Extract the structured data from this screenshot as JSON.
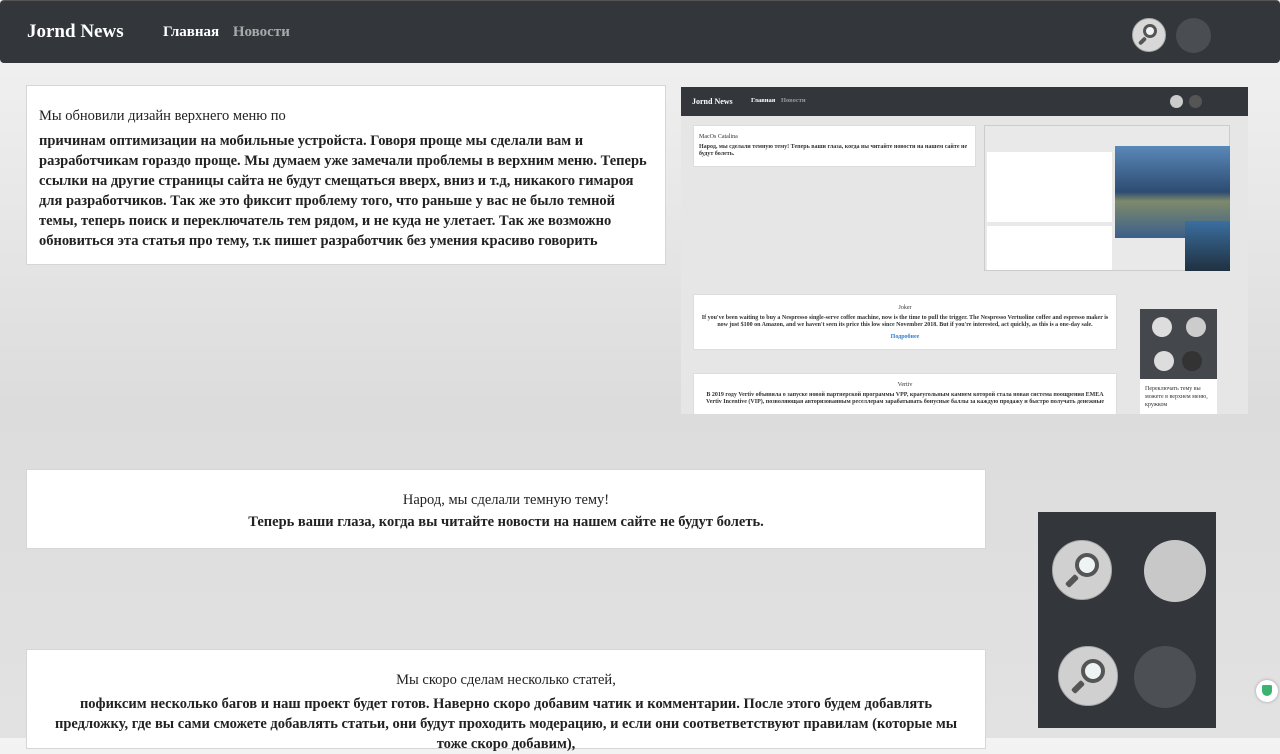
{
  "header": {
    "logo": "Jornd News",
    "nav": [
      "Главная",
      "Новости"
    ]
  },
  "card1": {
    "lead": "Мы обновили дизайн верхнего меню по",
    "body": "причинам оптимизации на мобильные устройста. Говоря проще мы сделали вам и разработчикам гораздо проще. Мы думаем уже замечали проблемы в верхним меню. Теперь ссылки на другие страницы сайта не будут смещаться вверх, вниз и т.д, никакого гимароя для разработчиков. Так же это фиксит проблему того, что раньше у вас не было темной темы, теперь поиск и переключатель тем рядом, и не куда не улетает. Так же возможно обновиться эта статья про тему, т.к пишет разработчик без умения красиво говорить"
  },
  "screenshot": {
    "logo": "Jornd News",
    "nav_home": "Главная",
    "nav_news": "Новости",
    "mini_a_title": "MacOs Catalina",
    "mini_a_text": "Народ, мы сделали темную тему! Теперь ваши глаза, когда вы читайте новости на нашем сайте не будут болеть.",
    "mini_b_title": "Joker",
    "mini_b_text": "If you've been waiting to buy a Nespresso single-serve coffee machine, now is the time to pull the trigger. The Nespresso Vertuoline coffee and espresso maker is now just $100 on Amazon, and we haven't seen its price this low since November 2018. But if you're interested, act quickly, as this is a one-day sale.",
    "mini_b_more": "Подробнее",
    "mini_c_title": "Vertiv",
    "mini_c_text": "В 2019 году Vertiv объявила о запуске новой партнерской программы VPP, краеугольным камнем которой стала новая система поощрения EMEA Vertiv Incentive (VIP), позволяющая авторизованным реселлерам зарабатывать бонусные баллы за каждую продажу и быстро получать денежные",
    "gadget_text": "Переключать тему вы можете в верхнем меню, кружком"
  },
  "card2": {
    "lead": "Народ, мы сделали темную тему!",
    "body": "Теперь ваши глаза, когда вы читайте новости на нашем сайте не будут болеть."
  },
  "card3": {
    "lead": "Мы скоро сделам несколько статей,",
    "body": "пофиксим несколько багов и наш проект будет готов. Наверно скоро добавим чатик и комментарии. После этого будем добавлять предложку, где вы сами сможете добавлять статьи, они будут проходить модерацию, и если они соответветствуют правилам (которые мы тоже скоро добавим),"
  },
  "icons": {
    "search": "search-icon",
    "theme": "theme-toggle-icon",
    "shield": "shield-icon"
  }
}
